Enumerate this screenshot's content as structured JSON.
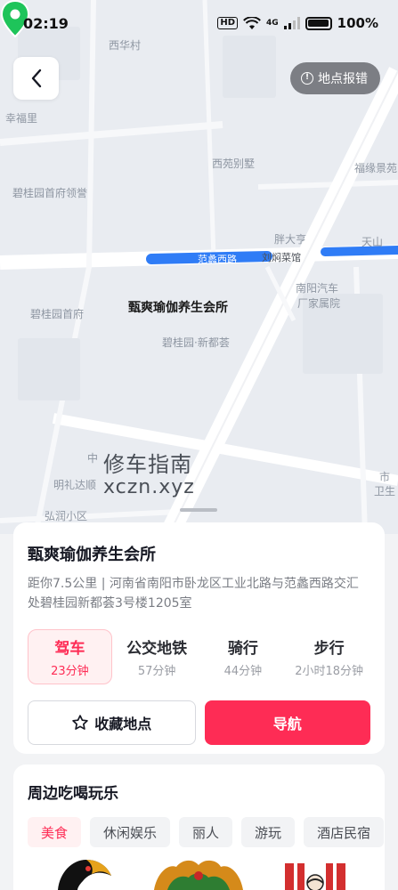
{
  "status_bar": {
    "time": "02:19",
    "network": "HD",
    "signal": "4G",
    "battery": "100%"
  },
  "map": {
    "labels": [
      "西华村",
      "幸福里",
      "西苑别墅",
      "福缘景苑",
      "碧桂园首府领誉",
      "胖大亨",
      "天山",
      "南阳汽车",
      "厂家属院",
      "碧桂园首府",
      "碧桂园·新都荟",
      "中",
      "明礼达顺",
      "弘润小区",
      "市",
      "卫生"
    ],
    "road_label": "范蠡西路",
    "road_label2": "刘焖菜馆",
    "poi_name": "甄爽瑜伽养生会所",
    "watermark_line1": "修车指南",
    "watermark_line2": "xczn.xyz"
  },
  "buttons": {
    "back_icon": "chevron-left",
    "report": "地点报错"
  },
  "place": {
    "title": "甄爽瑜伽养生会所",
    "address": "距你7.5公里 | 河南省南阳市卧龙区工业北路与范蠡西路交汇处碧桂园新都荟3号楼1205室"
  },
  "modes": [
    {
      "name": "驾车",
      "time": "23分钟",
      "active": true
    },
    {
      "name": "公交地铁",
      "time": "57分钟",
      "active": false
    },
    {
      "name": "骑行",
      "time": "44分钟",
      "active": false
    },
    {
      "name": "步行",
      "time": "2小时18分钟",
      "active": false
    }
  ],
  "actions": {
    "favorite": "收藏地点",
    "navigate": "导航"
  },
  "nearby": {
    "title": "周边吃喝玩乐",
    "chips": [
      "美食",
      "休闲娱乐",
      "丽人",
      "游玩",
      "酒店民宿"
    ]
  },
  "colors": {
    "accent": "#fe2c55",
    "pin": "#1ec45a",
    "route": "#2f7cf6"
  }
}
